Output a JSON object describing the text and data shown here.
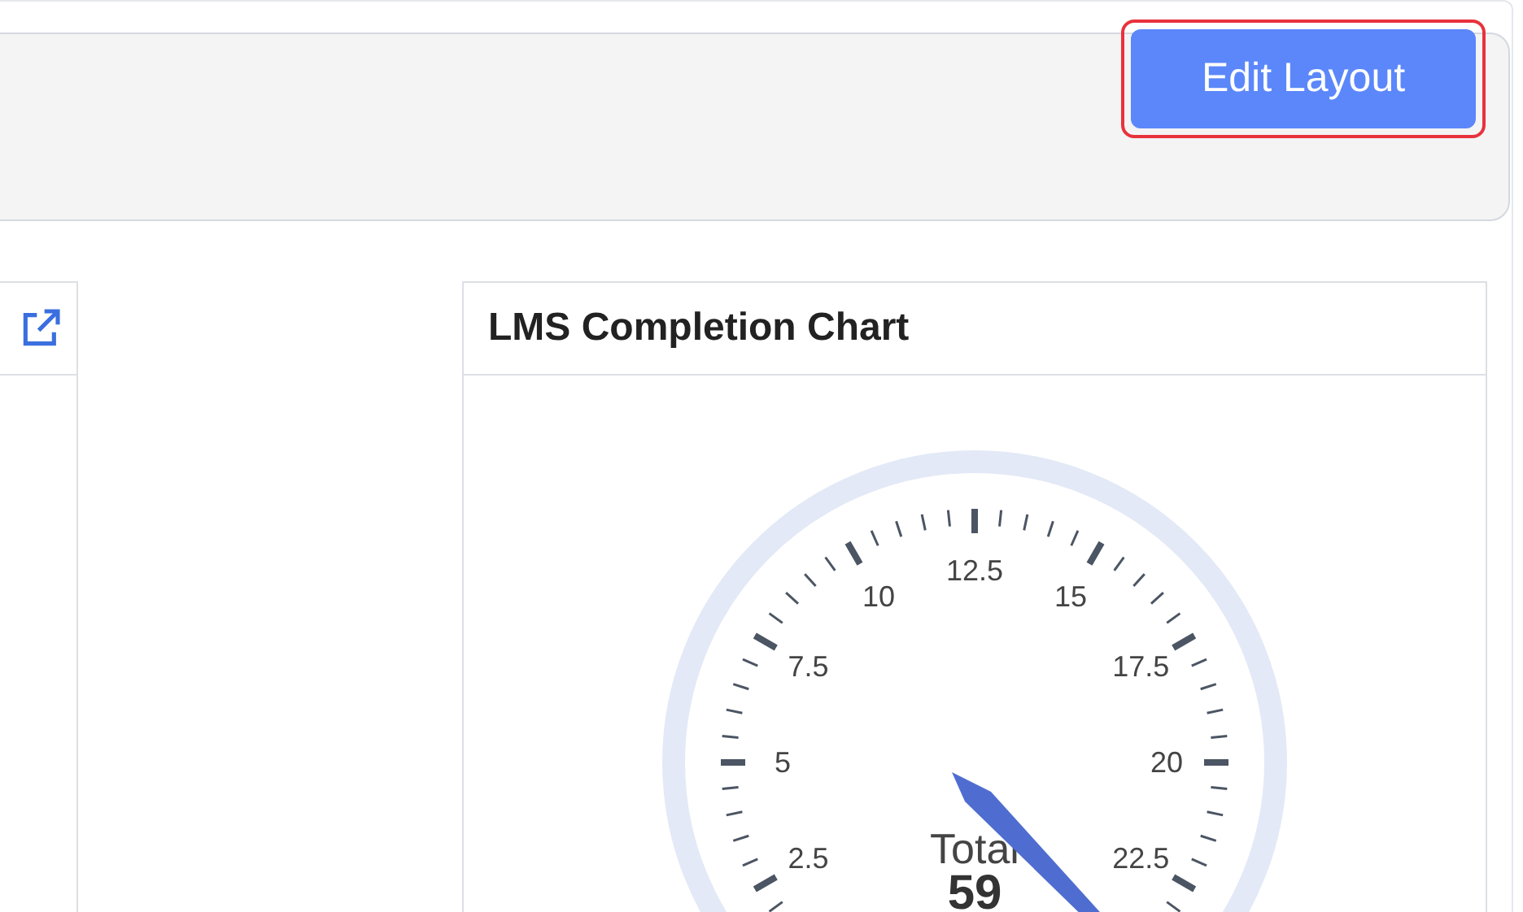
{
  "toolbar": {
    "button": "Edit Layout",
    "highlighted": true
  },
  "cards": [
    {
      "kind": "stub"
    },
    {
      "kind": "gauge",
      "title": "LMS Completion Chart",
      "gauge": {
        "scale_labels": [
          "2.5",
          "5",
          "7.5",
          "10",
          "12.5",
          "15",
          "17.5",
          "20",
          "22.5"
        ],
        "center_label": "Total",
        "center_value": "59"
      }
    }
  ]
}
